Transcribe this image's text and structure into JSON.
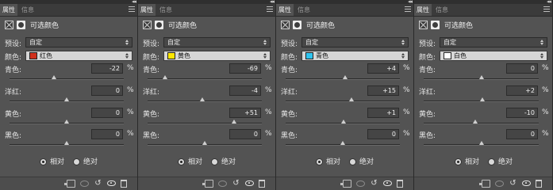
{
  "tabs": {
    "properties": "属性",
    "info": "信息"
  },
  "panel_title": "可选颜色",
  "preset_label": "预设:",
  "preset_value": "自定",
  "colors_label": "颜色:",
  "method": {
    "relative": "相对",
    "absolute": "绝对"
  },
  "percent_sign": "%",
  "slider_labels": [
    "青色:",
    "洋红:",
    "黄色:",
    "黑色:"
  ],
  "panels": [
    {
      "color_name": "红色",
      "swatch_color": "#d0301c",
      "values": [
        {
          "text": "-22",
          "level": -22
        },
        {
          "text": "0",
          "level": 0
        },
        {
          "text": "0",
          "level": 0
        },
        {
          "text": "0",
          "level": 0
        }
      ]
    },
    {
      "color_name": "黄色",
      "swatch_color": "#ffe600",
      "values": [
        {
          "text": "-69",
          "level": -69
        },
        {
          "text": "-4",
          "level": -4
        },
        {
          "text": "+51",
          "level": 51
        },
        {
          "text": "0",
          "level": 0
        }
      ]
    },
    {
      "color_name": "青色",
      "swatch_color": "#2ec4f0",
      "values": [
        {
          "text": "+4",
          "level": 4
        },
        {
          "text": "+15",
          "level": 15
        },
        {
          "text": "+1",
          "level": 1
        },
        {
          "text": "0",
          "level": 0
        }
      ]
    },
    {
      "color_name": "白色",
      "swatch_color": "#ffffff",
      "values": [
        {
          "text": "0",
          "level": 0
        },
        {
          "text": "+2",
          "level": 2
        },
        {
          "text": "-10",
          "level": -10
        },
        {
          "text": "0",
          "level": 0
        }
      ]
    }
  ],
  "icons": {
    "bottom": [
      "clip-to-layer-icon",
      "view-previous-state-icon",
      "reset-icon",
      "toggle-visibility-icon",
      "delete-icon"
    ]
  }
}
